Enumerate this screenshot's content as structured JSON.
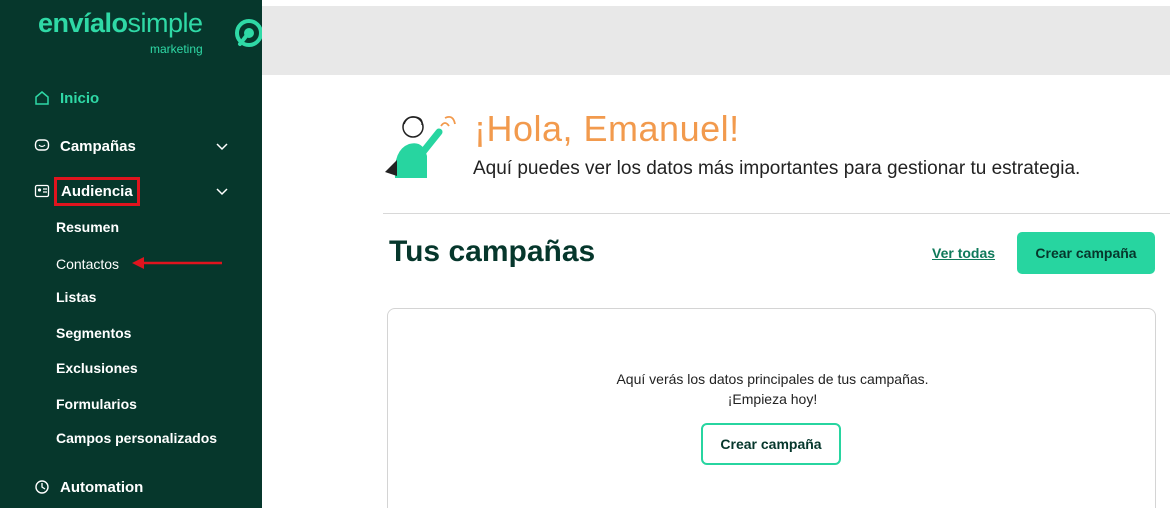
{
  "brand": {
    "name_bold": "envíalo",
    "name_light": "simple",
    "tagline": "marketing"
  },
  "sidebar": {
    "items": [
      {
        "label": "Inicio",
        "icon": "home-icon",
        "active": true
      },
      {
        "label": "Campañas",
        "icon": "chat-icon",
        "expandable": true
      },
      {
        "label": "Audiencia",
        "icon": "contact-card-icon",
        "expandable": true,
        "highlighted": true
      },
      {
        "label": "Automation",
        "icon": "automation-icon"
      }
    ],
    "audiencia_sub": [
      "Resumen",
      "Contactos",
      "Listas",
      "Segmentos",
      "Exclusiones",
      "Formularios",
      "Campos personalizados"
    ]
  },
  "main": {
    "greeting": "¡Hola, Emanuel!",
    "subtitle": "Aquí puedes ver los datos más importantes para gestionar tu estrategia.",
    "section_title": "Tus campañas",
    "see_all": "Ver todas",
    "create_button": "Crear campaña",
    "empty_line1": "Aquí verás los datos principales de tus campañas.",
    "empty_line2": "¡Empieza hoy!",
    "empty_button": "Crear campaña"
  },
  "colors": {
    "sidebar_bg": "#06372c",
    "accent": "#27d5a0",
    "greeting": "#f29a4d",
    "annotation": "#e0141e"
  }
}
